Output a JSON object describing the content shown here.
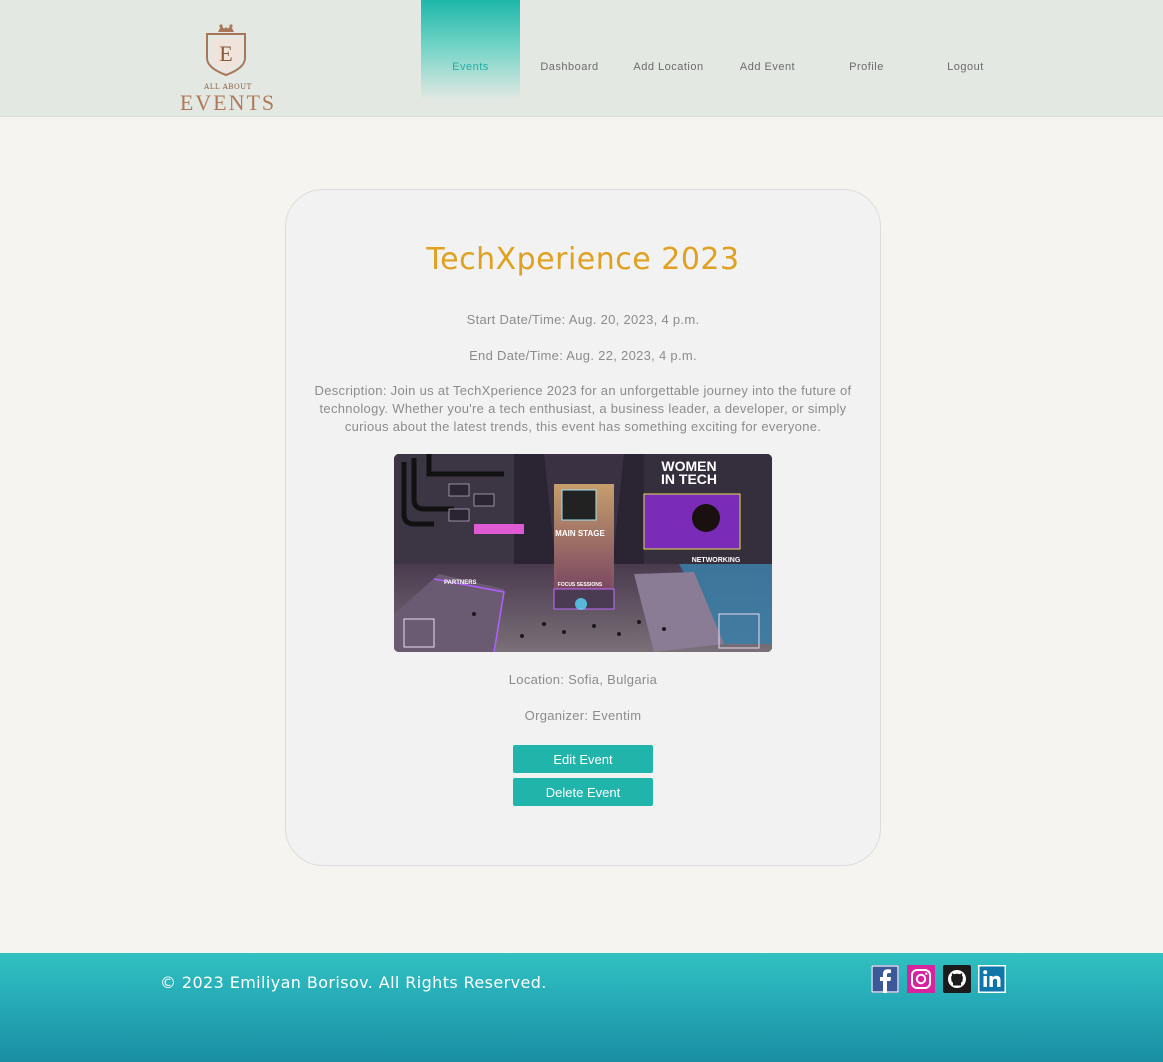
{
  "header": {
    "logo": {
      "letter": "E",
      "small_text": "ALL ABOUT",
      "big_text": "EVENTS"
    },
    "nav": [
      {
        "label": "Events",
        "active": true
      },
      {
        "label": "Dashboard",
        "active": false
      },
      {
        "label": "Add Location",
        "active": false
      },
      {
        "label": "Add Event",
        "active": false
      },
      {
        "label": "Profile",
        "active": false
      },
      {
        "label": "Logout",
        "active": false
      }
    ]
  },
  "event": {
    "title": "TechXperience 2023",
    "start": "Start Date/Time: Aug. 20, 2023, 4 p.m.",
    "end": "End Date/Time: Aug. 22, 2023, 4 p.m.",
    "description": "Description: Join us at TechXperience 2023 for an unforgettable journey into the future of technology. Whether you're a tech enthusiast, a business leader, a developer, or simply curious about the latest trends, this event has something exciting for everyone.",
    "image": {
      "signs": {
        "women_in_tech_1": "WOMEN",
        "women_in_tech_2": "IN TECH",
        "main_stage": "MAIN STAGE",
        "networking": "NETWORKING",
        "partners": "PARTNERS",
        "focus_sessions": "FOCUS SESSIONS"
      }
    },
    "location": "Location: Sofia, Bulgaria",
    "organizer": "Organizer: Eventim",
    "edit_label": "Edit Event",
    "delete_label": "Delete Event"
  },
  "footer": {
    "copyright": "© 2023 Emiliyan Borisov. All Rights Reserved.",
    "social": [
      {
        "icon": "facebook-icon",
        "color": "#3b5998"
      },
      {
        "icon": "instagram-icon",
        "color": "#d6249f"
      },
      {
        "icon": "github-icon",
        "color": "#1b1b1b"
      },
      {
        "icon": "linkedin-icon",
        "color": "#0e76a8"
      }
    ]
  },
  "colors": {
    "accent": "#20b4aa",
    "title": "#e0a020",
    "header_bg": "#e3e8e3",
    "page_bg": "#f5f4f1"
  }
}
